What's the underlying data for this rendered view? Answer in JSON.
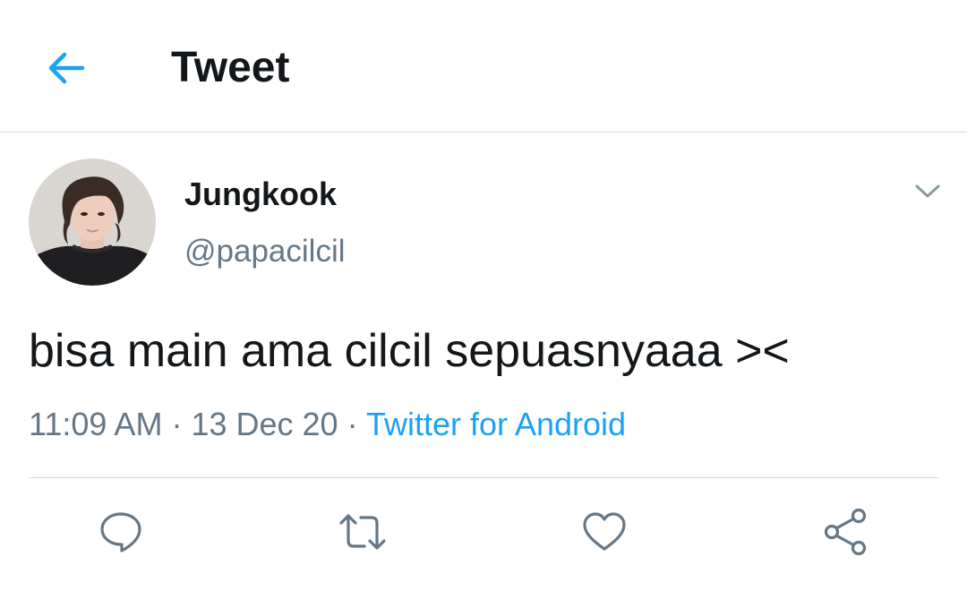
{
  "header": {
    "back_icon": "arrow-left-icon",
    "title": "Tweet"
  },
  "tweet": {
    "author": {
      "name": "Jungkook",
      "handle": "@papacilcil"
    },
    "text": "bisa main ama cilcil sepuasnyaaa ><",
    "time": "11:09 AM",
    "separator": "·",
    "date": "13 Dec 20",
    "source": "Twitter for Android"
  },
  "actions": [
    {
      "name": "reply",
      "icon": "speech-bubble-icon"
    },
    {
      "name": "retweet",
      "icon": "retweet-icon"
    },
    {
      "name": "like",
      "icon": "heart-icon"
    },
    {
      "name": "share",
      "icon": "share-icon"
    }
  ],
  "colors": {
    "accent": "#1da1f2",
    "text_primary": "#14171a",
    "text_secondary": "#657786",
    "divider": "#d9dde1",
    "icon_gray": "#657786"
  }
}
